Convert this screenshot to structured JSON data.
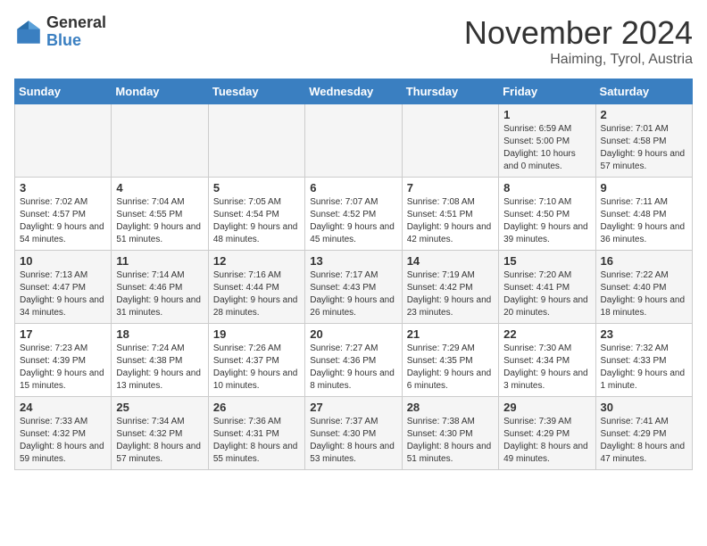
{
  "logo": {
    "general": "General",
    "blue": "Blue"
  },
  "header": {
    "month": "November 2024",
    "location": "Haiming, Tyrol, Austria"
  },
  "days_of_week": [
    "Sunday",
    "Monday",
    "Tuesday",
    "Wednesday",
    "Thursday",
    "Friday",
    "Saturday"
  ],
  "weeks": [
    [
      {
        "day": "",
        "content": ""
      },
      {
        "day": "",
        "content": ""
      },
      {
        "day": "",
        "content": ""
      },
      {
        "day": "",
        "content": ""
      },
      {
        "day": "",
        "content": ""
      },
      {
        "day": "1",
        "content": "Sunrise: 6:59 AM\nSunset: 5:00 PM\nDaylight: 10 hours and 0 minutes."
      },
      {
        "day": "2",
        "content": "Sunrise: 7:01 AM\nSunset: 4:58 PM\nDaylight: 9 hours and 57 minutes."
      }
    ],
    [
      {
        "day": "3",
        "content": "Sunrise: 7:02 AM\nSunset: 4:57 PM\nDaylight: 9 hours and 54 minutes."
      },
      {
        "day": "4",
        "content": "Sunrise: 7:04 AM\nSunset: 4:55 PM\nDaylight: 9 hours and 51 minutes."
      },
      {
        "day": "5",
        "content": "Sunrise: 7:05 AM\nSunset: 4:54 PM\nDaylight: 9 hours and 48 minutes."
      },
      {
        "day": "6",
        "content": "Sunrise: 7:07 AM\nSunset: 4:52 PM\nDaylight: 9 hours and 45 minutes."
      },
      {
        "day": "7",
        "content": "Sunrise: 7:08 AM\nSunset: 4:51 PM\nDaylight: 9 hours and 42 minutes."
      },
      {
        "day": "8",
        "content": "Sunrise: 7:10 AM\nSunset: 4:50 PM\nDaylight: 9 hours and 39 minutes."
      },
      {
        "day": "9",
        "content": "Sunrise: 7:11 AM\nSunset: 4:48 PM\nDaylight: 9 hours and 36 minutes."
      }
    ],
    [
      {
        "day": "10",
        "content": "Sunrise: 7:13 AM\nSunset: 4:47 PM\nDaylight: 9 hours and 34 minutes."
      },
      {
        "day": "11",
        "content": "Sunrise: 7:14 AM\nSunset: 4:46 PM\nDaylight: 9 hours and 31 minutes."
      },
      {
        "day": "12",
        "content": "Sunrise: 7:16 AM\nSunset: 4:44 PM\nDaylight: 9 hours and 28 minutes."
      },
      {
        "day": "13",
        "content": "Sunrise: 7:17 AM\nSunset: 4:43 PM\nDaylight: 9 hours and 26 minutes."
      },
      {
        "day": "14",
        "content": "Sunrise: 7:19 AM\nSunset: 4:42 PM\nDaylight: 9 hours and 23 minutes."
      },
      {
        "day": "15",
        "content": "Sunrise: 7:20 AM\nSunset: 4:41 PM\nDaylight: 9 hours and 20 minutes."
      },
      {
        "day": "16",
        "content": "Sunrise: 7:22 AM\nSunset: 4:40 PM\nDaylight: 9 hours and 18 minutes."
      }
    ],
    [
      {
        "day": "17",
        "content": "Sunrise: 7:23 AM\nSunset: 4:39 PM\nDaylight: 9 hours and 15 minutes."
      },
      {
        "day": "18",
        "content": "Sunrise: 7:24 AM\nSunset: 4:38 PM\nDaylight: 9 hours and 13 minutes."
      },
      {
        "day": "19",
        "content": "Sunrise: 7:26 AM\nSunset: 4:37 PM\nDaylight: 9 hours and 10 minutes."
      },
      {
        "day": "20",
        "content": "Sunrise: 7:27 AM\nSunset: 4:36 PM\nDaylight: 9 hours and 8 minutes."
      },
      {
        "day": "21",
        "content": "Sunrise: 7:29 AM\nSunset: 4:35 PM\nDaylight: 9 hours and 6 minutes."
      },
      {
        "day": "22",
        "content": "Sunrise: 7:30 AM\nSunset: 4:34 PM\nDaylight: 9 hours and 3 minutes."
      },
      {
        "day": "23",
        "content": "Sunrise: 7:32 AM\nSunset: 4:33 PM\nDaylight: 9 hours and 1 minute."
      }
    ],
    [
      {
        "day": "24",
        "content": "Sunrise: 7:33 AM\nSunset: 4:32 PM\nDaylight: 8 hours and 59 minutes."
      },
      {
        "day": "25",
        "content": "Sunrise: 7:34 AM\nSunset: 4:32 PM\nDaylight: 8 hours and 57 minutes."
      },
      {
        "day": "26",
        "content": "Sunrise: 7:36 AM\nSunset: 4:31 PM\nDaylight: 8 hours and 55 minutes."
      },
      {
        "day": "27",
        "content": "Sunrise: 7:37 AM\nSunset: 4:30 PM\nDaylight: 8 hours and 53 minutes."
      },
      {
        "day": "28",
        "content": "Sunrise: 7:38 AM\nSunset: 4:30 PM\nDaylight: 8 hours and 51 minutes."
      },
      {
        "day": "29",
        "content": "Sunrise: 7:39 AM\nSunset: 4:29 PM\nDaylight: 8 hours and 49 minutes."
      },
      {
        "day": "30",
        "content": "Sunrise: 7:41 AM\nSunset: 4:29 PM\nDaylight: 8 hours and 47 minutes."
      }
    ]
  ]
}
